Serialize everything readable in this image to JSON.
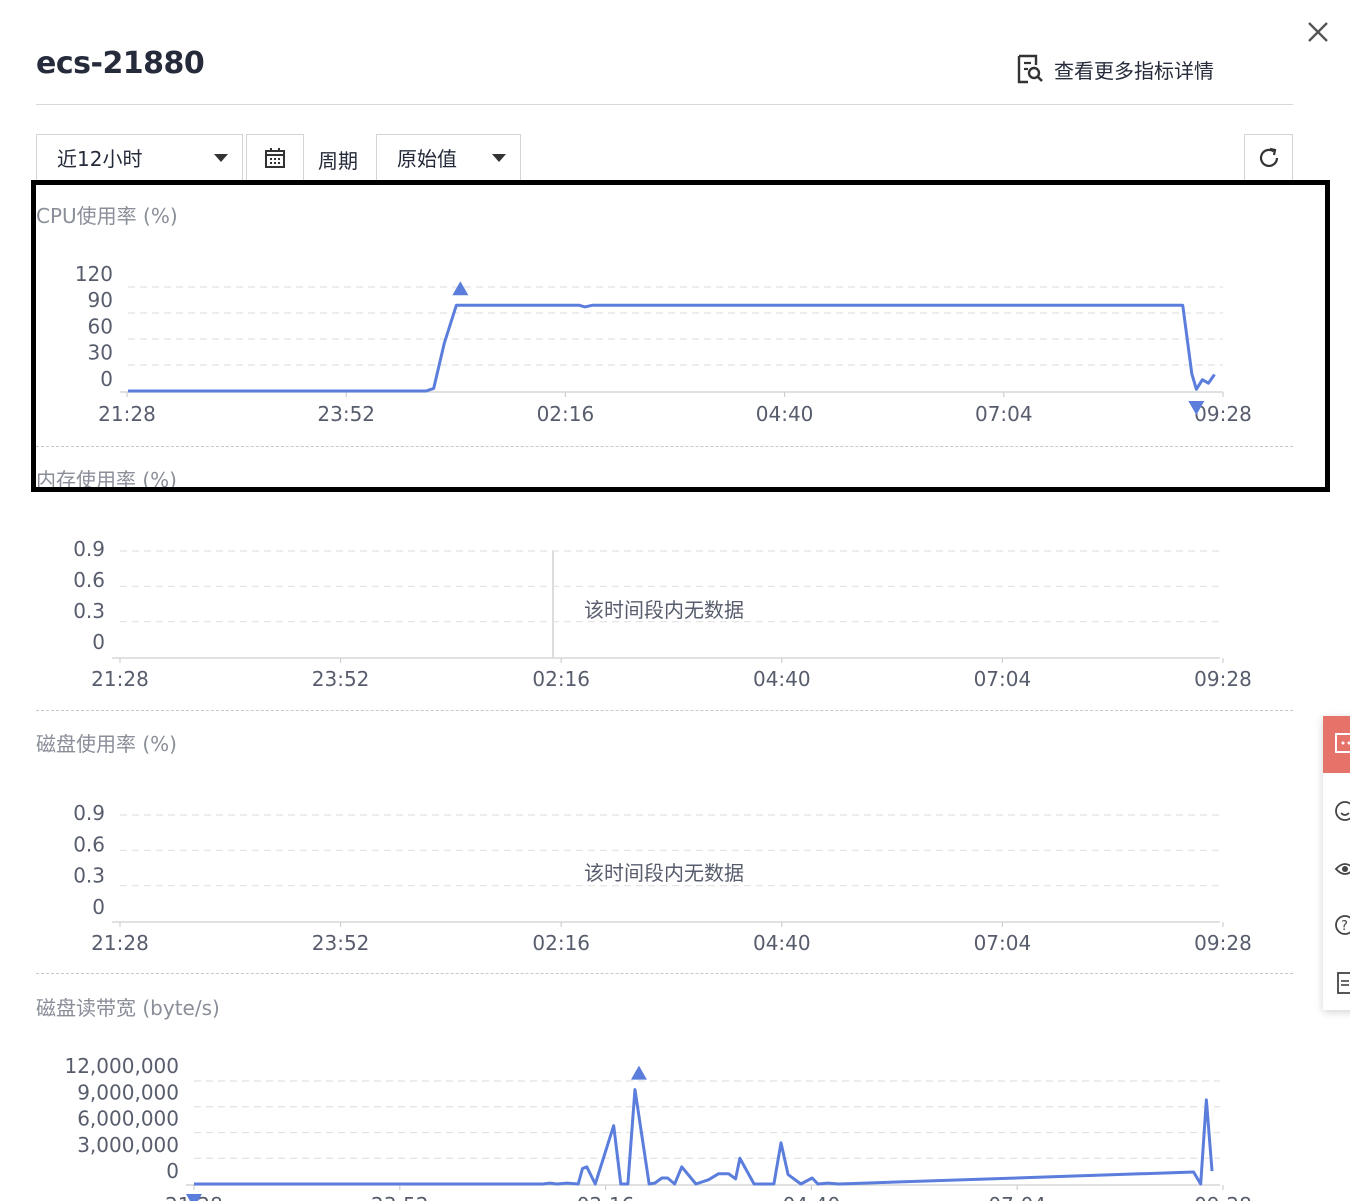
{
  "header": {
    "title": "ecs-21880",
    "more_link": "查看更多指标详情"
  },
  "toolbar": {
    "time_range": "近12小时",
    "period_label": "周期",
    "period_value": "原始值"
  },
  "colors": {
    "series": "#5b7ddc",
    "grid": "#e2e2e2",
    "axis_text": "#575d6c",
    "title_text": "#8a8e99",
    "side_accent": "#e5736a"
  },
  "x_ticks": [
    "21:28",
    "23:52",
    "02:16",
    "04:40",
    "07:04",
    "09:28"
  ],
  "charts": {
    "cpu": {
      "title": "CPU使用率 (%)",
      "y_ticks": [
        "120",
        "90",
        "60",
        "30",
        "0"
      ]
    },
    "mem": {
      "title": "内存使用率 (%)",
      "y_ticks": [
        "0.9",
        "0.6",
        "0.3",
        "0"
      ],
      "no_data": "该时间段内无数据"
    },
    "disk": {
      "title": "磁盘使用率 (%)",
      "y_ticks": [
        "0.9",
        "0.6",
        "0.3",
        "0"
      ],
      "no_data": "该时间段内无数据"
    },
    "read": {
      "title": "磁盘读带宽 (byte/s)",
      "y_ticks": [
        "12,000,000",
        "9,000,000",
        "6,000,000",
        "3,000,000",
        "0"
      ]
    }
  },
  "chart_data": [
    {
      "type": "line",
      "title": "CPU使用率 (%)",
      "x_range": [
        "21:28",
        "09:28"
      ],
      "ylim": [
        0,
        120
      ],
      "x": [
        "21:28",
        "00:45",
        "00:50",
        "00:57",
        "01:05",
        "02:26",
        "02:30",
        "02:35",
        "09:05",
        "09:11",
        "09:14",
        "09:18",
        "09:22",
        "09:26"
      ],
      "series": [
        {
          "values": [
            0,
            0,
            3,
            55,
            99,
            99,
            97,
            99,
            99,
            20,
            2,
            13,
            9,
            19
          ]
        }
      ],
      "markers": {
        "max": "01:05",
        "min": "09:14"
      }
    },
    {
      "type": "line",
      "title": "内存使用率 (%)",
      "x_range": [
        "21:28",
        "09:28"
      ],
      "ylim": [
        0,
        0.9
      ],
      "series": []
    },
    {
      "type": "line",
      "title": "磁盘使用率 (%)",
      "x_range": [
        "21:28",
        "09:28"
      ],
      "ylim": [
        0,
        0.9
      ],
      "series": []
    },
    {
      "type": "line",
      "title": "磁盘读带宽 (byte/s)",
      "x_range": [
        "21:28",
        "09:28"
      ],
      "ylim": [
        0,
        12000000
      ],
      "x": [
        "21:28",
        "01:22",
        "01:34",
        "01:39",
        "01:44",
        "01:51",
        "01:59",
        "02:02",
        "02:05",
        "02:11",
        "02:24",
        "02:29",
        "02:34",
        "02:39",
        "02:49",
        "02:53",
        "02:58",
        "03:02",
        "03:07",
        "03:12",
        "03:22",
        "03:31",
        "03:38",
        "03:45",
        "03:50",
        "03:53",
        "04:03",
        "04:17",
        "04:22",
        "04:27",
        "04:36",
        "04:44",
        "04:48",
        "04:55",
        "05:03",
        "09:13",
        "09:18",
        "09:22",
        "09:26"
      ],
      "series": [
        {
          "values": [
            0,
            0,
            0,
            100000,
            0,
            100000,
            0,
            1800000,
            2000000,
            0,
            6800000,
            0,
            0,
            11000000,
            0,
            100000,
            700000,
            700000,
            0,
            2000000,
            0,
            500000,
            1200000,
            1200000,
            600000,
            3000000,
            0,
            0,
            4800000,
            1100000,
            0,
            700000,
            0,
            100000,
            0,
            1400000,
            0,
            9800000,
            1500000
          ]
        }
      ],
      "markers": {
        "max": "02:39",
        "min": "21:28"
      }
    }
  ]
}
